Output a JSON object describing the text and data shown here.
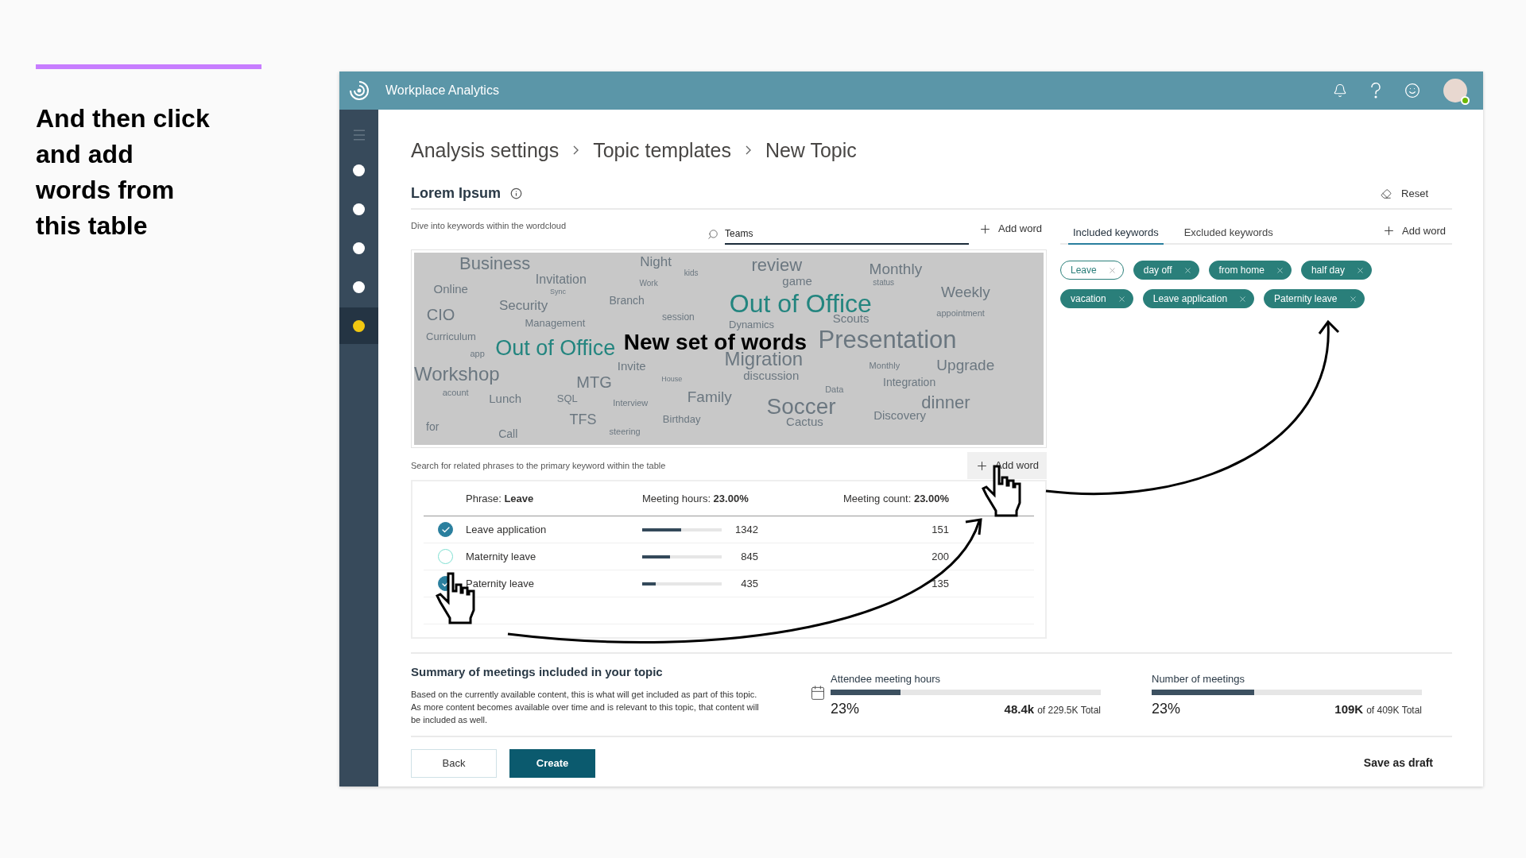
{
  "caption": {
    "lines": [
      "And then click",
      "and add",
      "words from",
      "this table"
    ]
  },
  "app": {
    "title": "Workplace Analytics"
  },
  "sidebar": {
    "items": [
      {
        "selected": false
      },
      {
        "selected": false
      },
      {
        "selected": false
      },
      {
        "selected": false
      },
      {
        "selected": false
      },
      {
        "selected": true
      }
    ]
  },
  "breadcrumb": [
    "Analysis settings",
    "Topic templates",
    "New Topic"
  ],
  "section": {
    "title": "Lorem Ipsum",
    "reset": "Reset"
  },
  "wordcloud": {
    "hint": "Dive into keywords within the wordcloud",
    "search_value": "Teams",
    "add_word": "Add word",
    "overlay_label": "New set of words",
    "words": [
      {
        "text": "Business",
        "highlighted": false
      },
      {
        "text": "Night",
        "highlighted": false
      },
      {
        "text": "kids",
        "highlighted": false
      },
      {
        "text": "review",
        "highlighted": false
      },
      {
        "text": "Monthly",
        "highlighted": false
      },
      {
        "text": "Invitation",
        "highlighted": false
      },
      {
        "text": "Work",
        "highlighted": false
      },
      {
        "text": "game",
        "highlighted": false
      },
      {
        "text": "status",
        "highlighted": false
      },
      {
        "text": "Online",
        "highlighted": false
      },
      {
        "text": "Sync",
        "highlighted": false
      },
      {
        "text": "Out of Office",
        "highlighted": true
      },
      {
        "text": "Weekly",
        "highlighted": false
      },
      {
        "text": "Security",
        "highlighted": false
      },
      {
        "text": "Branch",
        "highlighted": false
      },
      {
        "text": "CIO",
        "highlighted": false
      },
      {
        "text": "Management",
        "highlighted": false
      },
      {
        "text": "session",
        "highlighted": false
      },
      {
        "text": "Scouts",
        "highlighted": false
      },
      {
        "text": "appointment",
        "highlighted": false
      },
      {
        "text": "Dynamics",
        "highlighted": false
      },
      {
        "text": "Curriculum",
        "highlighted": false
      },
      {
        "text": "app",
        "highlighted": false
      },
      {
        "text": "Out of Office",
        "highlighted": true
      },
      {
        "text": "Presentation",
        "highlighted": false
      },
      {
        "text": "Invite",
        "highlighted": false
      },
      {
        "text": "Migration",
        "highlighted": false
      },
      {
        "text": "Monthly",
        "highlighted": false
      },
      {
        "text": "Upgrade",
        "highlighted": false
      },
      {
        "text": "Workshop",
        "highlighted": false
      },
      {
        "text": "discussion",
        "highlighted": false
      },
      {
        "text": "MTG",
        "highlighted": false
      },
      {
        "text": "House",
        "highlighted": false
      },
      {
        "text": "Integration",
        "highlighted": false
      },
      {
        "text": "Data",
        "highlighted": false
      },
      {
        "text": "acount",
        "highlighted": false
      },
      {
        "text": "Lunch",
        "highlighted": false
      },
      {
        "text": "SQL",
        "highlighted": false
      },
      {
        "text": "Interview",
        "highlighted": false
      },
      {
        "text": "Family",
        "highlighted": false
      },
      {
        "text": "Soccer",
        "highlighted": false
      },
      {
        "text": "dinner",
        "highlighted": false
      },
      {
        "text": "TFS",
        "highlighted": false
      },
      {
        "text": "Birthday",
        "highlighted": false
      },
      {
        "text": "Cactus",
        "highlighted": false
      },
      {
        "text": "Discovery",
        "highlighted": false
      },
      {
        "text": "for",
        "highlighted": false
      },
      {
        "text": "Call",
        "highlighted": false
      },
      {
        "text": "steering",
        "highlighted": false
      }
    ]
  },
  "table": {
    "hint": "Search for related phrases to the primary keyword within the table",
    "add_word": "Add word",
    "columns": [
      "Phrase: **Leave**",
      "Meeting hours: **23.00%**",
      "Meeting count: **23.00%**"
    ],
    "rows": [
      {
        "checked": true,
        "phrase": "Leave application",
        "level": 0.49,
        "hours": "1342",
        "count": "151"
      },
      {
        "checked": false,
        "phrase": "Maternity leave",
        "level": 0.35,
        "hours": "845",
        "count": "200"
      },
      {
        "checked": true,
        "phrase": "Paternity leave",
        "level": 0.17,
        "hours": "435",
        "count": "135"
      }
    ]
  },
  "keywords": {
    "tabs": [
      {
        "label": "Included keywords",
        "selected": true
      },
      {
        "label": "Excluded keywords",
        "selected": false
      }
    ],
    "add_word": "Add word",
    "chips": [
      {
        "label": "Leave",
        "kind": "primary"
      },
      {
        "label": "day off",
        "kind": "added"
      },
      {
        "label": "from home",
        "kind": "added"
      },
      {
        "label": "half day",
        "kind": "added"
      },
      {
        "label": "vacation",
        "kind": "added"
      },
      {
        "label": "Leave application",
        "kind": "added"
      },
      {
        "label": "Paternity leave",
        "kind": "added"
      }
    ]
  },
  "summary": {
    "title": "Summary of meetings included in your topic",
    "description": "Based on the currently available content, this is what will get included as part of this topic. As more content becomes available over time and is relevant to this topic, that content will be included as well.",
    "metrics": [
      {
        "label": "Attendee meeting hours",
        "level": 0.26,
        "percent": "23%",
        "value": "48.4k",
        "total": "of 229.5K Total"
      },
      {
        "label": "Number of meetings",
        "level": 0.38,
        "percent": "23%",
        "value": "109K",
        "total": "of 409K Total"
      }
    ]
  },
  "buttons": {
    "back": "Back",
    "create": "Create",
    "draft": "Save as draft"
  }
}
